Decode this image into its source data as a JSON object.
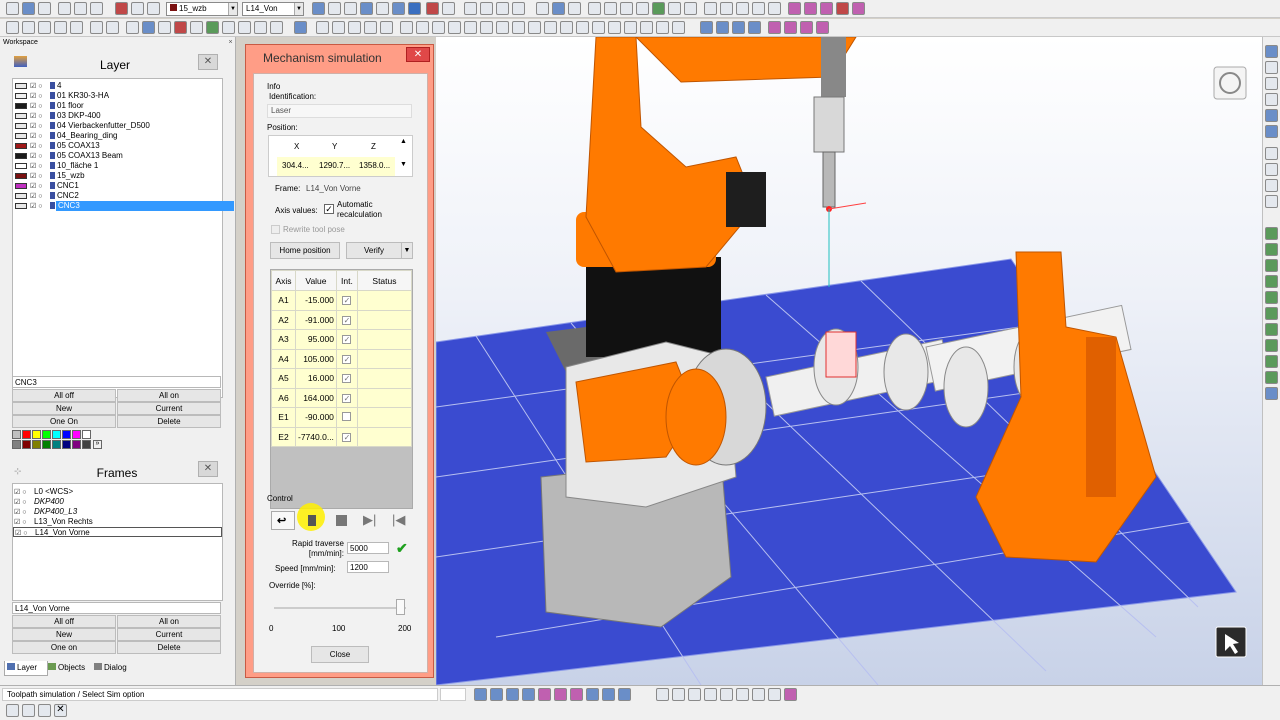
{
  "toolbar": {
    "layer_select": "15_wzb",
    "frame_select": "L14_Von"
  },
  "workspace": {
    "title": "Workspace"
  },
  "layer": {
    "title": "Layer",
    "items": [
      {
        "name": "4",
        "color": "#e8e8e8"
      },
      {
        "name": "01 KR30-3-HA",
        "color": "#f0f0f0"
      },
      {
        "name": "01 floor",
        "color": "#1a1a1a"
      },
      {
        "name": "03 DKP-400",
        "color": "#e8e8e8"
      },
      {
        "name": "04 Vierbackenfutter_D500",
        "color": "#e8e8e8"
      },
      {
        "name": "04_Bearing_ding",
        "color": "#e8e8e8"
      },
      {
        "name": "05 COAX13",
        "color": "#a01818"
      },
      {
        "name": "05 COAX13 Beam",
        "color": "#1a1a1a"
      },
      {
        "name": "10_fläche 1",
        "color": "#ffffff"
      },
      {
        "name": "15_wzb",
        "color": "#7a1010"
      },
      {
        "name": "CNC1",
        "color": "#c030c0"
      },
      {
        "name": "CNC2",
        "color": "#e8e8e8"
      },
      {
        "name": "CNC3",
        "color": "#e8e8e8"
      }
    ],
    "current": "CNC3",
    "buttons": {
      "all_off": "All off",
      "all_on": "All on",
      "new": "New",
      "current": "Current",
      "one_on": "One On",
      "delete": "Delete"
    },
    "palette": [
      "#c0c0c0",
      "#ff0000",
      "#ffff00",
      "#00ff00",
      "#00ffff",
      "#0000ff",
      "#ff00ff",
      "#ffffff",
      "#808080",
      "#800000",
      "#808000",
      "#008000",
      "#008080",
      "#000080",
      "#800080",
      "#404040"
    ]
  },
  "frames": {
    "title": "Frames",
    "items": [
      "L0 <WCS>",
      "DKP400",
      "DKP400_L3",
      "L13_Von Rechts",
      "L14_Von Vorne"
    ],
    "current": "L14_Von Vorne",
    "buttons": {
      "all_off": "All off",
      "all_on": "All on",
      "new": "New",
      "current": "Current",
      "one_on": "One on",
      "delete": "Delete"
    }
  },
  "tabs": [
    "Layer",
    "Objects",
    "Dialog"
  ],
  "mech": {
    "title": "Mechanism simulation",
    "info": "Info",
    "ident_label": "Identification:",
    "ident_value": "Laser",
    "pos_label": "Position:",
    "pos_headers": [
      "X",
      "Y",
      "Z"
    ],
    "pos_values": [
      "304.4...",
      "1290.7...",
      "1358.0..."
    ],
    "frame_label": "Frame:",
    "frame_value": "L14_Von Vorne",
    "axis_values_label": "Axis values:",
    "auto_recalc": "Automatic recalculation",
    "rewrite": "Rewrite tool pose",
    "home_btn": "Home position",
    "verify_btn": "Verify",
    "table_headers": [
      "Axis",
      "Value",
      "Int.",
      "Status"
    ],
    "axes": [
      {
        "axis": "A1",
        "value": "-15.000",
        "int": true
      },
      {
        "axis": "A2",
        "value": "-91.000",
        "int": true
      },
      {
        "axis": "A3",
        "value": "95.000",
        "int": true
      },
      {
        "axis": "A4",
        "value": "105.000",
        "int": true
      },
      {
        "axis": "A5",
        "value": "16.000",
        "int": true
      },
      {
        "axis": "A6",
        "value": "164.000",
        "int": true
      },
      {
        "axis": "E1",
        "value": "-90.000",
        "int": false
      },
      {
        "axis": "E2",
        "value": "-7740.0...",
        "int": true
      }
    ],
    "control": "Control",
    "rapid_label": "Rapid traverse [mm/min]:",
    "rapid_value": "5000",
    "speed_label": "Speed [mm/min]:",
    "speed_value": "1200",
    "override_label": "Override [%]:",
    "override_ticks": [
      "0",
      "100",
      "200"
    ],
    "override_value": 190,
    "close_btn": "Close"
  },
  "status": {
    "text": "Toolpath simulation  /  Select Sim option"
  }
}
